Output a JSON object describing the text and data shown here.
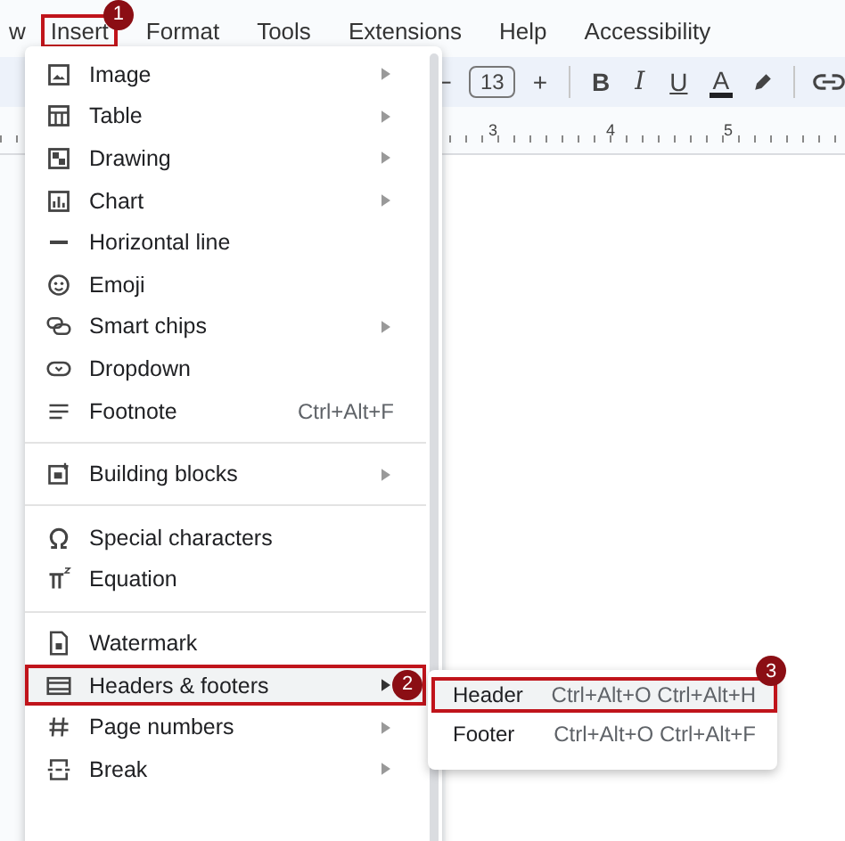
{
  "menu_bar": {
    "items": [
      {
        "label": "w",
        "selected": false
      },
      {
        "label": "Insert",
        "selected": true,
        "badge": "1"
      },
      {
        "label": "Format",
        "selected": false
      },
      {
        "label": "Tools",
        "selected": false
      },
      {
        "label": "Extensions",
        "selected": false
      },
      {
        "label": "Help",
        "selected": false
      },
      {
        "label": "Accessibility",
        "selected": false
      }
    ]
  },
  "toolbar": {
    "font_size": "13",
    "minus": "−",
    "plus": "+",
    "bold": "B",
    "italic": "I",
    "underline": "U",
    "text_color": "A"
  },
  "ruler": {
    "marks": [
      "3",
      "4",
      "5"
    ]
  },
  "insert_menu": {
    "groups": [
      [
        {
          "label": "Image",
          "has_submenu": true,
          "highlighted": false
        },
        {
          "label": "Table",
          "has_submenu": true,
          "highlighted": false
        },
        {
          "label": "Drawing",
          "has_submenu": true,
          "highlighted": false
        },
        {
          "label": "Chart",
          "has_submenu": true,
          "highlighted": false
        },
        {
          "label": "Horizontal line",
          "has_submenu": false,
          "highlighted": false
        },
        {
          "label": "Emoji",
          "has_submenu": false,
          "highlighted": false
        },
        {
          "label": "Smart chips",
          "has_submenu": true,
          "highlighted": false
        },
        {
          "label": "Dropdown",
          "has_submenu": false,
          "highlighted": false
        },
        {
          "label": "Footnote",
          "shortcut": "Ctrl+Alt+F",
          "has_submenu": false,
          "highlighted": false
        }
      ],
      [
        {
          "label": "Building blocks",
          "has_submenu": true,
          "highlighted": false
        }
      ],
      [
        {
          "label": "Special characters",
          "has_submenu": false,
          "highlighted": false
        },
        {
          "label": "Equation",
          "has_submenu": false,
          "highlighted": false
        }
      ],
      [
        {
          "label": "Watermark",
          "has_submenu": false,
          "highlighted": false
        },
        {
          "label": "Headers & footers",
          "has_submenu": true,
          "highlighted": true,
          "badge": "2"
        },
        {
          "label": "Page numbers",
          "has_submenu": true,
          "highlighted": false
        },
        {
          "label": "Break",
          "has_submenu": true,
          "highlighted": false
        }
      ]
    ]
  },
  "submenu": {
    "items": [
      {
        "label": "Header",
        "shortcut": "Ctrl+Alt+O Ctrl+Alt+H",
        "highlighted": true,
        "badge": "3"
      },
      {
        "label": "Footer",
        "shortcut": "Ctrl+Alt+O Ctrl+Alt+F",
        "highlighted": false
      }
    ]
  }
}
